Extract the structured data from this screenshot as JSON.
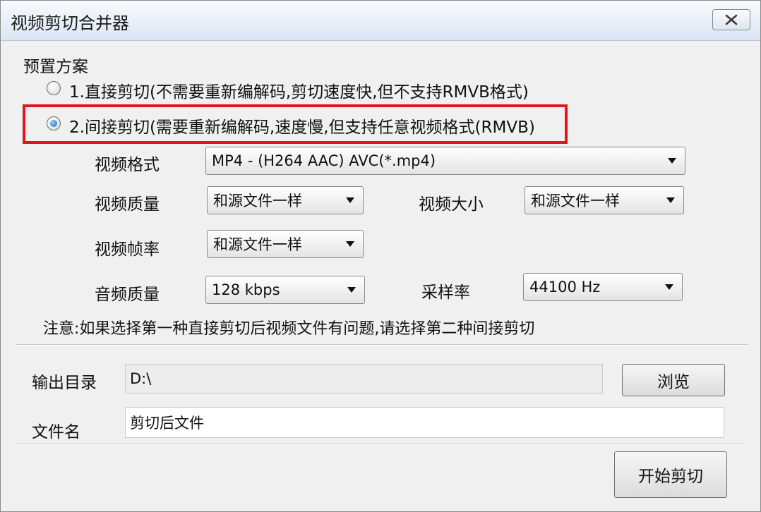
{
  "window": {
    "title": "视频剪切合并器"
  },
  "presets": {
    "group_label": "预置方案",
    "option1": "1.直接剪切(不需要重新编解码,剪切速度快,但不支持RMVB格式)",
    "option2": "2.间接剪切(需要重新编解码,速度慢,但支持任意视频格式(RMVB)",
    "selected": 2
  },
  "settings": {
    "video_format_label": "视频格式",
    "video_format_value": "MP4 - (H264 AAC) AVC(*.mp4)",
    "video_quality_label": "视频质量",
    "video_quality_value": "和源文件一样",
    "video_size_label": "视频大小",
    "video_size_value": "和源文件一样",
    "frame_rate_label": "视频帧率",
    "frame_rate_value": "和源文件一样",
    "audio_quality_label": "音频质量",
    "audio_quality_value": "128 kbps",
    "sample_rate_label": "采样率",
    "sample_rate_value": "44100 Hz"
  },
  "note": "注意:如果选择第一种直接剪切后视频文件有问题,请选择第二种间接剪切",
  "output": {
    "dir_label": "输出目录",
    "dir_value": "D:\\",
    "browse_label": "浏览",
    "filename_label": "文件名",
    "filename_value": "剪切后文件"
  },
  "actions": {
    "start_label": "开始剪切"
  },
  "colors": {
    "highlight": "#e4141b",
    "radio_selected": "#1c62b8"
  }
}
